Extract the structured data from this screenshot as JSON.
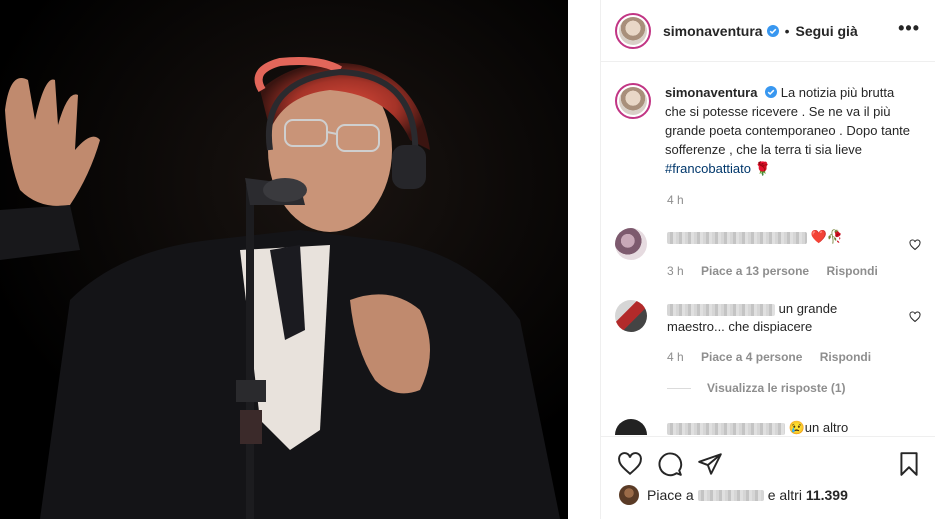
{
  "post": {
    "username": "simonaventura",
    "follow_dot": "•",
    "follow_label": "Segui già",
    "more_label": "•••"
  },
  "caption": {
    "username": "simonaventura",
    "text": "La notizia più brutta che si potesse ricevere . Se ne va il più grande poeta contemporaneo . Dopo tante sofferenze , che la terra ti sia lieve",
    "hashtag": "#francobattiato",
    "emoji": "🌹",
    "time": "4 h"
  },
  "comments": [
    {
      "text": "❤️🥀",
      "time": "3 h",
      "likes": "Piace a 13 persone",
      "reply": "Rispondi"
    },
    {
      "text": "un grande maestro... che dispiacere",
      "time": "4 h",
      "likes": "Piace a 4 persone",
      "reply": "Rispondi",
      "view_replies": "Visualizza le risposte (1)"
    },
    {
      "text": "😢un altro"
    }
  ],
  "likes": {
    "prefix": "Piace a",
    "suffix": "e altri",
    "count": "11.399"
  },
  "icons": {
    "heart": "heart-icon",
    "comment": "comment-icon",
    "share": "share-icon",
    "save": "bookmark-icon",
    "verified": "verified-badge-icon",
    "more": "more-options-icon"
  },
  "colors": {
    "verified": "#3897f0",
    "link": "#00376b",
    "muted": "#8e8e8e",
    "story_ring": "#c13584"
  }
}
